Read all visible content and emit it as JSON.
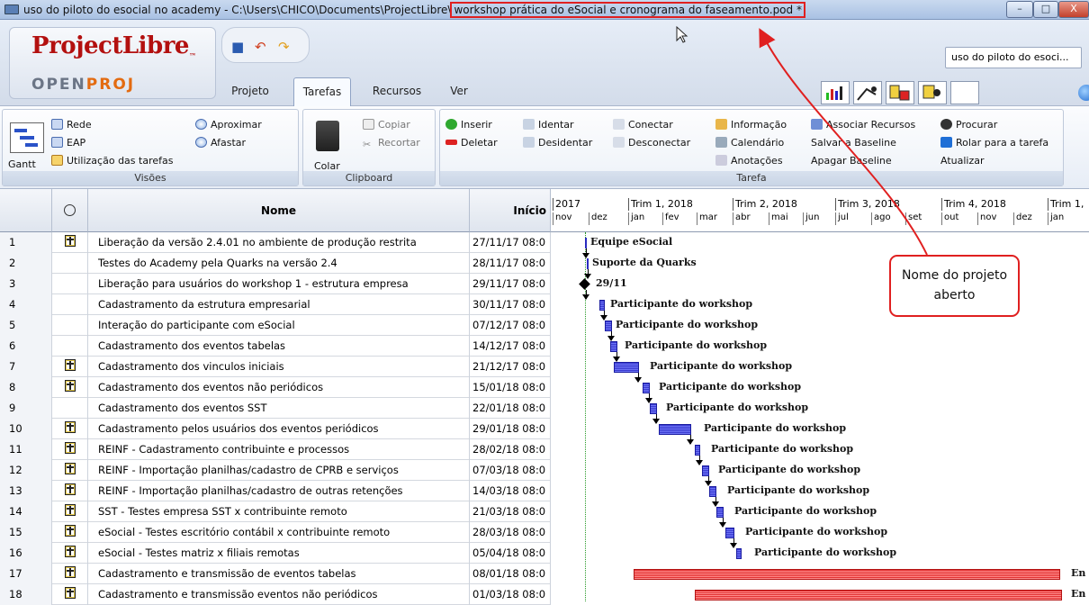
{
  "window": {
    "title_prefix": "uso do piloto do esocial no academy - C:\\Users\\CHICO\\Documents\\ProjectLibre\\",
    "title_file": "workshop prática do eSocial e cronograma do faseamento.pod *",
    "controls": [
      "–",
      "□",
      "X"
    ]
  },
  "brand": {
    "name": "ProjectLibre",
    "tm": "™",
    "openproj_a": "OPEN",
    "openproj_b": "PROJ"
  },
  "project_combo": "uso do piloto do esoci...",
  "tabs": [
    "Projeto",
    "Tarefas",
    "Recursos",
    "Ver"
  ],
  "selected_tab": "Tarefas",
  "ribbon": {
    "views": {
      "label": "Visões",
      "gantt": "Gantt",
      "rede": "Rede",
      "eap": "EAP",
      "utilizacao": "Utilização das tarefas",
      "aproximar": "Aproximar",
      "afastar": "Afastar"
    },
    "clipboard": {
      "label": "Clipboard",
      "colar": "Colar",
      "copiar": "Copiar",
      "recortar": "Recortar"
    },
    "task": {
      "label": "Tarefa",
      "inserir": "Inserir",
      "deletar": "Deletar",
      "identar": "Identar",
      "desidentar": "Desidentar",
      "conectar": "Conectar",
      "desconectar": "Desconectar",
      "informacao": "Informação",
      "calendario": "Calendário",
      "anotacoes": "Anotações",
      "associar": "Associar Recursos",
      "salvar_baseline": "Salvar a Baseline",
      "apagar_baseline": "Apagar Baseline",
      "procurar": "Procurar",
      "rolar": "Rolar para a tarefa",
      "atualizar": "Atualizar"
    }
  },
  "table": {
    "headers": {
      "name": "Nome",
      "start": "Início"
    },
    "rows": [
      {
        "n": "1",
        "ind": true,
        "name": "Liberação da versão 2.4.01 no ambiente de produção restrita",
        "start": "27/11/17 08:0"
      },
      {
        "n": "2",
        "ind": false,
        "name": "Testes do Academy pela Quarks na versão 2.4",
        "start": "28/11/17 08:0"
      },
      {
        "n": "3",
        "ind": false,
        "name": "Liberação para usuários do workshop 1 - estrutura empresa",
        "start": "29/11/17 08:0"
      },
      {
        "n": "4",
        "ind": false,
        "name": "Cadastramento da estrutura empresarial",
        "start": "30/11/17 08:0"
      },
      {
        "n": "5",
        "ind": false,
        "name": "Interação do participante com eSocial",
        "start": "07/12/17 08:0"
      },
      {
        "n": "6",
        "ind": false,
        "name": "Cadastramento dos eventos tabelas",
        "start": "14/12/17 08:0"
      },
      {
        "n": "7",
        "ind": true,
        "name": "Cadastramento dos vinculos iniciais",
        "start": "21/12/17 08:0"
      },
      {
        "n": "8",
        "ind": true,
        "name": "Cadastramento dos eventos não periódicos",
        "start": "15/01/18 08:0"
      },
      {
        "n": "9",
        "ind": false,
        "name": "Cadastramento dos eventos SST",
        "start": "22/01/18 08:0"
      },
      {
        "n": "10",
        "ind": true,
        "name": "Cadastramento pelos usuários dos eventos periódicos",
        "start": "29/01/18 08:0"
      },
      {
        "n": "11",
        "ind": true,
        "name": "REINF - Cadastramento contribuinte e processos",
        "start": "28/02/18 08:0"
      },
      {
        "n": "12",
        "ind": true,
        "name": "REINF - Importação planilhas/cadastro de CPRB e serviços",
        "start": "07/03/18 08:0"
      },
      {
        "n": "13",
        "ind": true,
        "name": "REINF - Importação planilhas/cadastro de outras retenções",
        "start": "14/03/18 08:0"
      },
      {
        "n": "14",
        "ind": true,
        "name": "SST - Testes empresa SST x contribuinte remoto",
        "start": "21/03/18 08:0"
      },
      {
        "n": "15",
        "ind": true,
        "name": "eSocial - Testes escritório contábil x contribuinte remoto",
        "start": "28/03/18 08:0"
      },
      {
        "n": "16",
        "ind": true,
        "name": "eSocial - Testes matriz x filiais remotas",
        "start": "05/04/18 08:0"
      },
      {
        "n": "17",
        "ind": true,
        "name": "Cadastramento e transmissão de eventos tabelas",
        "start": "08/01/18 08:0"
      },
      {
        "n": "18",
        "ind": true,
        "name": "Cadastramento e transmissão eventos não periódicos",
        "start": "01/03/18 08:0"
      }
    ]
  },
  "timeline": {
    "quarters": [
      "2017",
      "Trim 1, 2018",
      "Trim 2, 2018",
      "Trim 3, 2018",
      "Trim 4, 2018",
      "Trim 1,"
    ],
    "months": [
      "nov",
      "dez",
      "jan",
      "fev",
      "mar",
      "abr",
      "mai",
      "jun",
      "jul",
      "ago",
      "set",
      "out",
      "nov",
      "dez",
      "jan"
    ]
  },
  "gantt_labels": [
    "Equipe eSocial",
    "Suporte da Quarks",
    "29/11",
    "Participante do workshop",
    "Participante do workshop",
    "Participante do workshop",
    "Participante do workshop",
    "Participante do workshop",
    "Participante do workshop",
    "Participante do workshop",
    "Participante do workshop",
    "Participante do workshop",
    "Participante do workshop",
    "Participante do workshop",
    "Participante do workshop",
    "Participante do workshop",
    "En",
    "En"
  ],
  "callout": "Nome do projeto\naberto",
  "colors": {
    "accent_red": "#e02020",
    "bar_blue": "#4a4ce0",
    "bar_red": "#ff5a5a"
  }
}
